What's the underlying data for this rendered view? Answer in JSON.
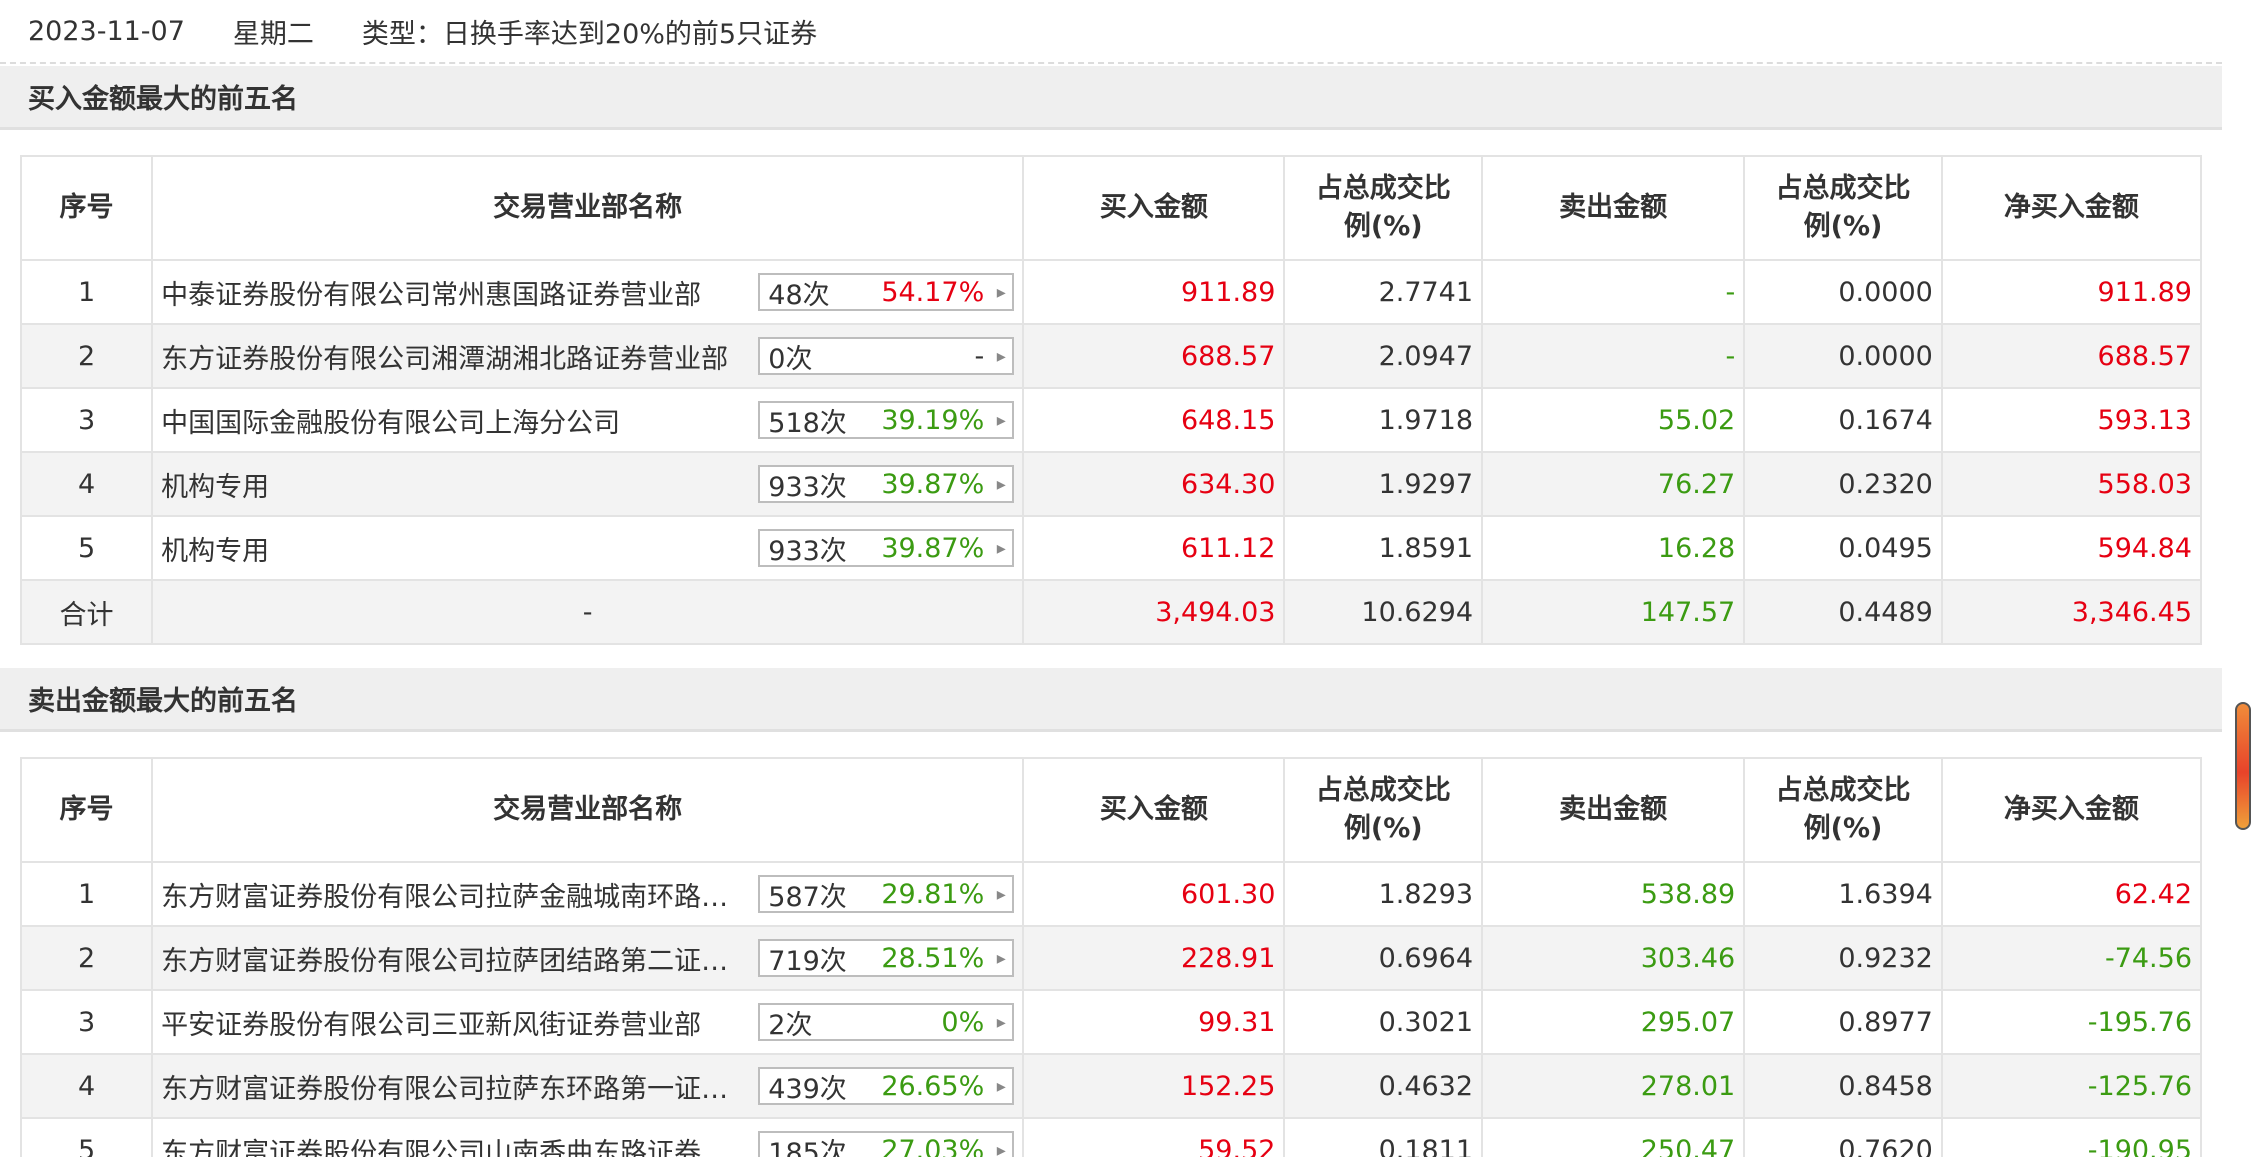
{
  "header": {
    "date": "2023-11-07",
    "weekday": "星期二",
    "type_text": "类型：日换手率达到20%的前5只证券"
  },
  "columns": {
    "seq": "序号",
    "dept": "交易营业部名称",
    "buy": "买入金额",
    "buy_pct": "占总成交比例(%)",
    "sell": "卖出金额",
    "sell_pct": "占总成交比例(%)",
    "net": "净买入金额"
  },
  "icons": {
    "badge_arrow": "triangle-right-icon"
  },
  "colors": {
    "up": "#e60012",
    "down": "#3b9b12"
  },
  "buy_section": {
    "title": "买入金额最大的前五名",
    "rows": [
      {
        "seq": "1",
        "name": "中泰证券股份有限公司常州惠国路证券营业部",
        "count": "48次",
        "rate": "54.17%",
        "rate_color": "red",
        "buy": "911.89",
        "buy_pct": "2.7741",
        "sell": "-",
        "sell_pct": "0.0000",
        "net": "911.89",
        "net_color": "red"
      },
      {
        "seq": "2",
        "name": "东方证券股份有限公司湘潭湖湘北路证券营业部",
        "count": "0次",
        "rate": "-",
        "rate_color": "plain",
        "buy": "688.57",
        "buy_pct": "2.0947",
        "sell": "-",
        "sell_pct": "0.0000",
        "net": "688.57",
        "net_color": "red"
      },
      {
        "seq": "3",
        "name": "中国国际金融股份有限公司上海分公司",
        "count": "518次",
        "rate": "39.19%",
        "rate_color": "green",
        "buy": "648.15",
        "buy_pct": "1.9718",
        "sell": "55.02",
        "sell_pct": "0.1674",
        "net": "593.13",
        "net_color": "red"
      },
      {
        "seq": "4",
        "name": "机构专用",
        "count": "933次",
        "rate": "39.87%",
        "rate_color": "green",
        "buy": "634.30",
        "buy_pct": "1.9297",
        "sell": "76.27",
        "sell_pct": "0.2320",
        "net": "558.03",
        "net_color": "red"
      },
      {
        "seq": "5",
        "name": "机构专用",
        "count": "933次",
        "rate": "39.87%",
        "rate_color": "green",
        "buy": "611.12",
        "buy_pct": "1.8591",
        "sell": "16.28",
        "sell_pct": "0.0495",
        "net": "594.84",
        "net_color": "red"
      }
    ],
    "total": {
      "label": "合计",
      "name": "-",
      "buy": "3,494.03",
      "buy_pct": "10.6294",
      "sell": "147.57",
      "sell_pct": "0.4489",
      "net": "3,346.45"
    }
  },
  "sell_section": {
    "title": "卖出金额最大的前五名",
    "rows": [
      {
        "seq": "1",
        "name": "东方财富证券股份有限公司拉萨金融城南环路证券营业部",
        "count": "587次",
        "rate": "29.81%",
        "rate_color": "green",
        "buy": "601.30",
        "buy_pct": "1.8293",
        "sell": "538.89",
        "sell_pct": "1.6394",
        "net": "62.42",
        "net_color": "red"
      },
      {
        "seq": "2",
        "name": "东方财富证券股份有限公司拉萨团结路第二证券营业部",
        "count": "719次",
        "rate": "28.51%",
        "rate_color": "green",
        "buy": "228.91",
        "buy_pct": "0.6964",
        "sell": "303.46",
        "sell_pct": "0.9232",
        "net": "-74.56",
        "net_color": "green"
      },
      {
        "seq": "3",
        "name": "平安证券股份有限公司三亚新风街证券营业部",
        "count": "2次",
        "rate": "0%",
        "rate_color": "green",
        "buy": "99.31",
        "buy_pct": "0.3021",
        "sell": "295.07",
        "sell_pct": "0.8977",
        "net": "-195.76",
        "net_color": "green"
      },
      {
        "seq": "4",
        "name": "东方财富证券股份有限公司拉萨东环路第一证券营业部",
        "count": "439次",
        "rate": "26.65%",
        "rate_color": "green",
        "buy": "152.25",
        "buy_pct": "0.4632",
        "sell": "278.01",
        "sell_pct": "0.8458",
        "net": "-125.76",
        "net_color": "green"
      },
      {
        "seq": "5",
        "name": "东方财富证券股份有限公司山南香曲东路证券营业部",
        "count": "185次",
        "rate": "27.03%",
        "rate_color": "green",
        "buy": "59.52",
        "buy_pct": "0.1811",
        "sell": "250.47",
        "sell_pct": "0.7620",
        "net": "-190.95",
        "net_color": "green"
      }
    ]
  }
}
